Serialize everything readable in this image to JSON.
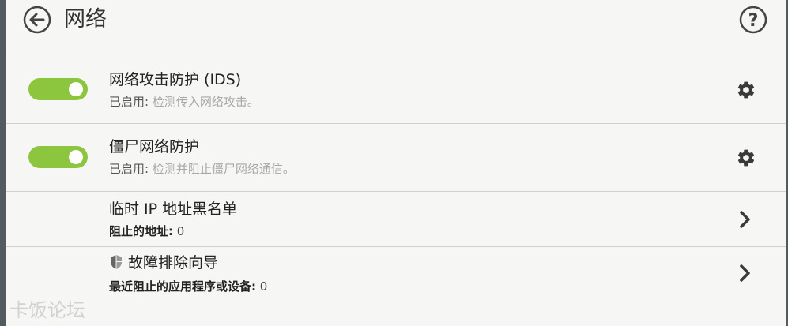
{
  "header": {
    "title": "网络",
    "back_icon": "back-arrow-circle-icon",
    "help_icon": "question-circle-icon"
  },
  "colors": {
    "toggle_on": "#8cc63f",
    "background": "#f6f6f5",
    "subtext": "#a8a8a8"
  },
  "items": [
    {
      "title": "网络攻击防护 (IDS)",
      "status": "已启用:",
      "description": "检测传入网络攻击。",
      "toggle": "on",
      "action_icon": "gear-icon"
    },
    {
      "title": "僵尸网络防护",
      "status": "已启用:",
      "description": "检测并阻止僵尸网络通信。",
      "toggle": "on",
      "action_icon": "gear-icon"
    },
    {
      "title": "临时 IP 地址黑名单",
      "label": "阻止的地址:",
      "value": "0",
      "action_icon": "chevron-right-icon"
    },
    {
      "title": "故障排除向导",
      "label": "最近阻止的应用程序或设备:",
      "value": "0",
      "title_icon": "shield-icon",
      "action_icon": "chevron-right-icon"
    }
  ],
  "watermark": "卡饭论坛"
}
